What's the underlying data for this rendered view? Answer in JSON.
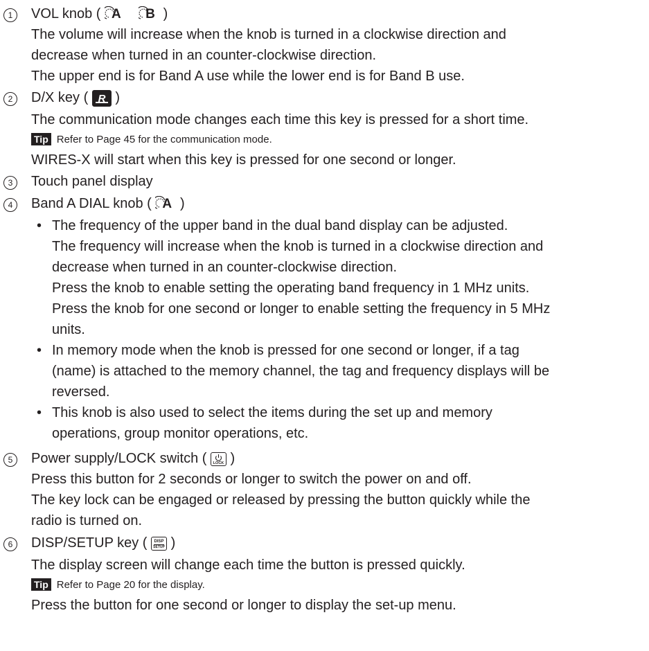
{
  "items": [
    {
      "num": "1",
      "title_prefix": "VOL knob (",
      "title_suffix": ")",
      "icons": [
        "vol-a-knob-icon",
        "vol-b-knob-icon"
      ],
      "icon_letters": [
        "A",
        "B"
      ],
      "lines": [
        "The volume will increase when the knob is turned in a clockwise direction and",
        "decrease when turned in an counter-clockwise direction.",
        "The upper end is for Band A use while the lower end is for Band B use."
      ]
    },
    {
      "num": "2",
      "title_prefix": "D/X key (",
      "title_suffix": ")",
      "icons": [
        "dx-key-icon"
      ],
      "lines": [
        "The communication mode changes each time this key is pressed for a short time."
      ],
      "tip_label": "Tip",
      "tip": "Refer to Page 45 for the communication mode.",
      "lines_after": [
        "WIRES-X will start when this key is pressed for one second or longer."
      ]
    },
    {
      "num": "3",
      "title": "Touch panel display"
    },
    {
      "num": "4",
      "title_prefix": "Band A DIAL knob (",
      "title_suffix": ")",
      "icons": [
        "dial-a-knob-icon"
      ],
      "icon_letters": [
        "A"
      ],
      "bullets": [
        [
          "The frequency of the upper band in the dual band display can be adjusted.",
          "The frequency will increase when the knob is turned in a clockwise direction and",
          "decrease when turned in an counter-clockwise direction.",
          "Press the knob to enable setting the operating band frequency in 1 MHz units.",
          "Press the knob for one second or longer to enable setting the frequency in 5 MHz",
          "units."
        ],
        [
          "In memory mode when the knob is pressed for one second or longer, if a tag",
          "(name) is attached to the memory channel, the tag and frequency displays will be",
          "reversed."
        ],
        [
          "This knob is also used to select the items during the set up and memory",
          "operations, group monitor operations, etc."
        ]
      ]
    },
    {
      "num": "5",
      "title_prefix": "Power supply/LOCK switch (",
      "title_suffix": ")",
      "icons": [
        "power-lock-key-icon"
      ],
      "icon_text": "LOCK",
      "lines": [
        "Press this button for 2 seconds or longer to switch the power on and off.",
        "The key lock can be engaged or released by pressing the button quickly while the",
        "radio is turned on."
      ]
    },
    {
      "num": "6",
      "title_prefix": "DISP/SETUP key (",
      "title_suffix": ")",
      "icons": [
        "disp-setup-key-icon"
      ],
      "icon_text": [
        "DISP",
        "SETUP"
      ],
      "lines": [
        "The display screen will change each time the button is pressed quickly."
      ],
      "tip_label": "Tip",
      "tip": "Refer to Page 20 for the display.",
      "lines_after": [
        "Press the button for one second or longer to display the set-up menu."
      ]
    }
  ]
}
